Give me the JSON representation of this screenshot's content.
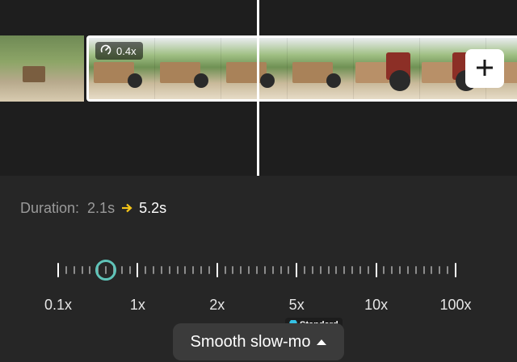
{
  "timeline": {
    "selected_clip": {
      "speed_label": "0.4x",
      "speed_icon": "speed-gauge-icon"
    },
    "add_button": {
      "icon": "plus-icon"
    }
  },
  "duration": {
    "label": "Duration:",
    "from": "2.1s",
    "to": "5.2s",
    "arrow_color": "#f5c518"
  },
  "speed_slider": {
    "labels": [
      "0.1x",
      "1x",
      "2x",
      "5x",
      "10x",
      "100x"
    ],
    "current": "0.4x",
    "knob_color": "#5fc3b8"
  },
  "smooth_button": {
    "label": "Smooth slow-mo",
    "badge_label": "Standard",
    "badge_icon": "diamond-icon",
    "badge_icon_color": "#35c2e6"
  },
  "colors": {
    "timeline_bg": "#1e1e1e",
    "panel_bg": "#262626",
    "accent": "#5fc3b8"
  }
}
